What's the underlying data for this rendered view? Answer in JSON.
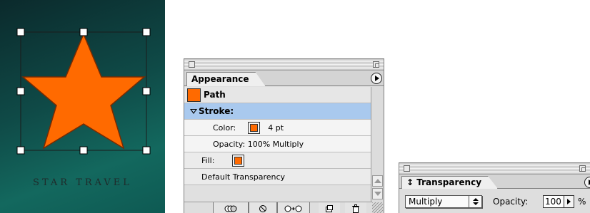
{
  "artwork": {
    "brand_text": "STAR TRAVEL",
    "star_fill": "#ff6a00",
    "star_stroke": "#7a2a00",
    "background": [
      "#0b2a2c",
      "#13685e"
    ]
  },
  "appearance": {
    "tab_label": "Appearance",
    "object_label": "Path",
    "stroke_label": "Stroke:",
    "color_label": "Color:",
    "stroke_weight": "4 pt",
    "opacity_line": "Opacity: 100% Multiply",
    "fill_label": "Fill:",
    "default_transparency": "Default Transparency",
    "swatch_color": "#ff6a00",
    "selected_row_color": "#a9c9ee"
  },
  "transparency": {
    "tab_label": "↕ Transparency",
    "blend_mode": "Multiply",
    "opacity_label": "Opacity:",
    "opacity_value": "100",
    "percent_sign": "%"
  }
}
